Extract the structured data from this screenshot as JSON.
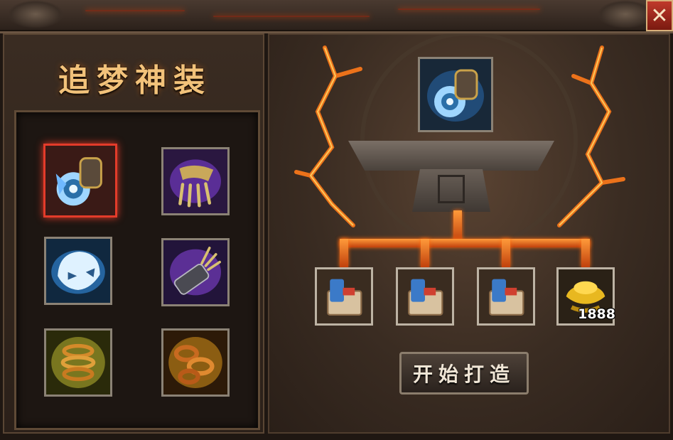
{
  "panel_title": "追梦神装",
  "close_label": "✕",
  "equipment_slots": [
    {
      "item": "gauntlet-armor-icon",
      "selected": true
    },
    {
      "item": "purple-claw-icon",
      "selected": false
    },
    {
      "item": "blue-helmet-icon",
      "selected": false
    },
    {
      "item": "purple-bracer-icon",
      "selected": false
    },
    {
      "item": "gold-coil-icon",
      "selected": false
    },
    {
      "item": "gold-chain-icon",
      "selected": false
    }
  ],
  "forge_target": {
    "item": "gauntlet-armor-icon"
  },
  "materials": [
    {
      "item": "scroll-blueprint-icon",
      "count": ""
    },
    {
      "item": "scroll-blueprint-icon",
      "count": ""
    },
    {
      "item": "scroll-blueprint-icon",
      "count": ""
    },
    {
      "item": "gold-ingot-icon",
      "count": "1888"
    }
  ],
  "forge_button": "开始打造",
  "colors": {
    "accent_gold": "#f2c27a",
    "selected_border": "#e33b2a",
    "lava": "#ff7a1a"
  }
}
